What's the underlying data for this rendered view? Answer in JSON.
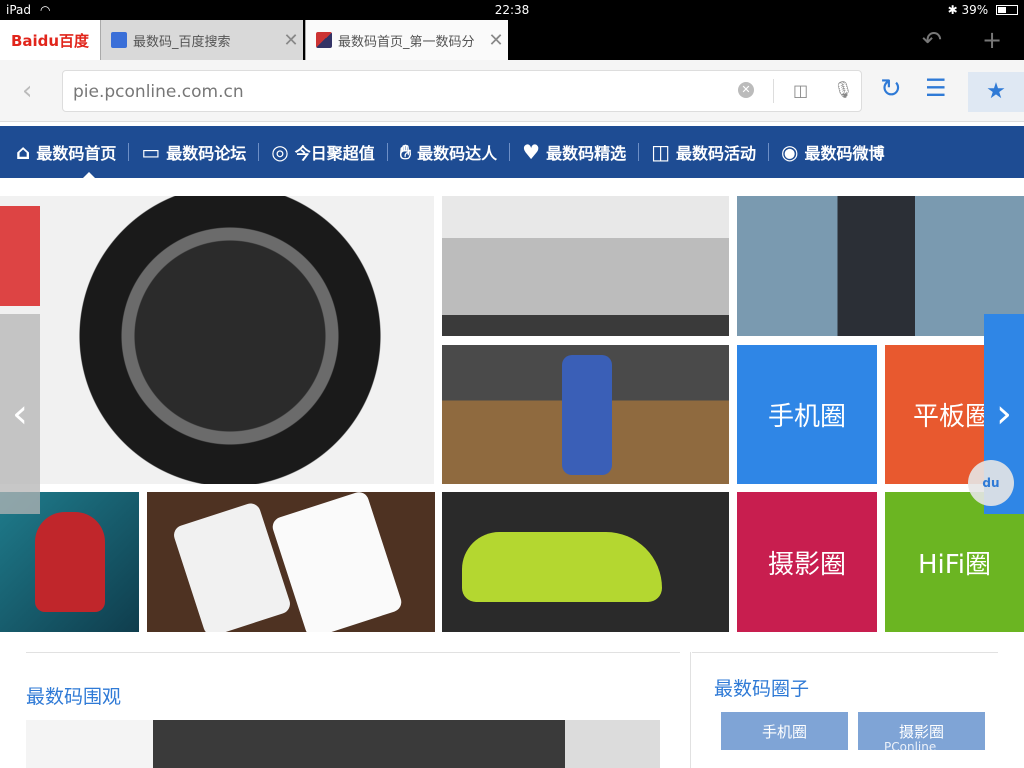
{
  "status": {
    "device": "iPad",
    "time": "22:38",
    "battery": "39%",
    "battery_level": 0.39
  },
  "browser": {
    "logo": "Baidu百度",
    "tabs": [
      {
        "title": "最数码_百度搜索",
        "active": false
      },
      {
        "title": "最数码首页_第一数码分",
        "active": true
      }
    ],
    "url": "pie.pconline.com.cn",
    "icons": [
      "back-icon",
      "clear-icon",
      "camera-icon",
      "mic-icon",
      "reload-icon",
      "menu-icon",
      "bookmark-star-icon",
      "undo-icon",
      "add-tab-icon"
    ]
  },
  "nav": {
    "items": [
      {
        "label": "最数码首页",
        "icon": "home-icon"
      },
      {
        "label": "最数码论坛",
        "icon": "chat-icon"
      },
      {
        "label": "今日聚超值",
        "icon": "deal-icon"
      },
      {
        "label": "最数码达人",
        "icon": "hand-icon"
      },
      {
        "label": "最数码精选",
        "icon": "heart-icon"
      },
      {
        "label": "最数码活动",
        "icon": "camera-icon"
      },
      {
        "label": "最数码微博",
        "icon": "weibo-icon"
      }
    ],
    "color": "#1e4c93"
  },
  "tiles": [
    {
      "label": "手机圈",
      "color": "#2f86e6"
    },
    {
      "label": "平板圈",
      "color": "#e8592f"
    },
    {
      "label": "摄影圈",
      "color": "#c81e4f"
    },
    {
      "label": "HiFi圈",
      "color": "#6bb522"
    }
  ],
  "sections": {
    "left_title": "最数码围观",
    "right_title": "最数码圈子",
    "circle_chips": [
      "手机圈",
      "摄影圈"
    ]
  },
  "watermark": "PConline"
}
